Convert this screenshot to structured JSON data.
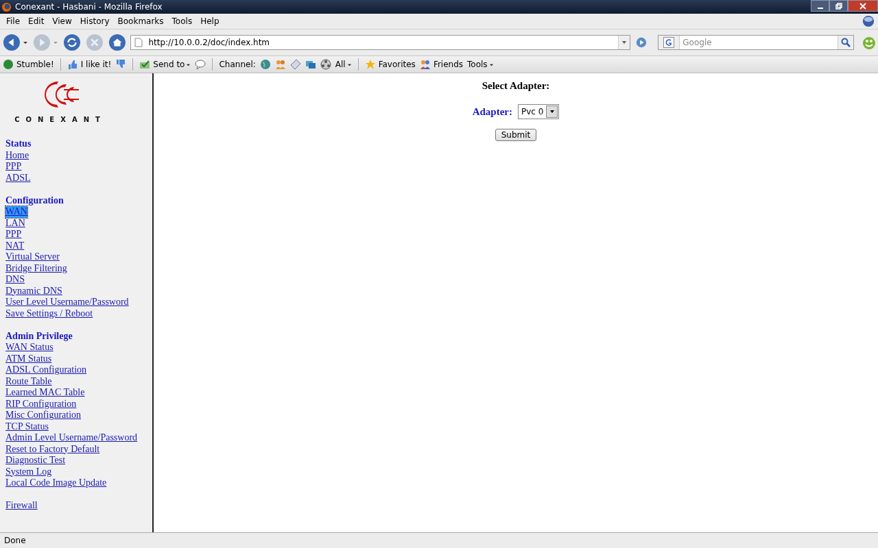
{
  "window": {
    "title": "Conexant - Hasbani - Mozilla Firefox"
  },
  "menu": [
    "File",
    "Edit",
    "View",
    "History",
    "Bookmarks",
    "Tools",
    "Help"
  ],
  "navigation": {
    "url": "http://10.0.0.2/doc/index.htm",
    "search_placeholder": "Google"
  },
  "bookmarks_toolbar": {
    "stumble": "Stumble!",
    "like": "I like it!",
    "send_to": "Send to",
    "channel": "Channel:",
    "all": "All",
    "favorites": "Favorites",
    "friends": "Friends",
    "tools": "Tools"
  },
  "sidebar": {
    "logo_text": "CONEXANT",
    "sections": [
      {
        "heading": "Status",
        "links": [
          {
            "label": "Home",
            "selected": false
          },
          {
            "label": "PPP",
            "selected": false
          },
          {
            "label": "ADSL",
            "selected": false
          }
        ]
      },
      {
        "heading": "Configuration",
        "links": [
          {
            "label": "WAN",
            "selected": true
          },
          {
            "label": "LAN",
            "selected": false
          },
          {
            "label": "PPP",
            "selected": false
          },
          {
            "label": "NAT",
            "selected": false
          },
          {
            "label": "Virtual Server",
            "selected": false
          },
          {
            "label": "Bridge Filtering",
            "selected": false
          },
          {
            "label": "DNS",
            "selected": false
          },
          {
            "label": "Dynamic DNS",
            "selected": false
          },
          {
            "label": "User Level Username/Password",
            "selected": false
          },
          {
            "label": "Save Settings / Reboot",
            "selected": false
          }
        ]
      },
      {
        "heading": "Admin Privilege",
        "links": [
          {
            "label": "WAN Status",
            "selected": false
          },
          {
            "label": "ATM Status",
            "selected": false
          },
          {
            "label": "ADSL Configuration",
            "selected": false
          },
          {
            "label": "Route Table",
            "selected": false
          },
          {
            "label": "Learned MAC Table",
            "selected": false
          },
          {
            "label": "RIP Configuration",
            "selected": false
          },
          {
            "label": "Misc Configuration",
            "selected": false
          },
          {
            "label": "TCP Status",
            "selected": false
          },
          {
            "label": "Admin Level Username/Password",
            "selected": false
          },
          {
            "label": "Reset to Factory Default",
            "selected": false
          },
          {
            "label": "Diagnostic Test",
            "selected": false
          },
          {
            "label": "System Log",
            "selected": false
          },
          {
            "label": "Local Code Image Update",
            "selected": false
          }
        ]
      },
      {
        "links": [
          {
            "label": "Firewall",
            "selected": false
          }
        ]
      }
    ]
  },
  "main": {
    "heading": "Select Adapter:",
    "adapter_label": "Adapter:",
    "adapter_value": "Pvc 0",
    "submit": "Submit"
  },
  "status_bar": "Done"
}
